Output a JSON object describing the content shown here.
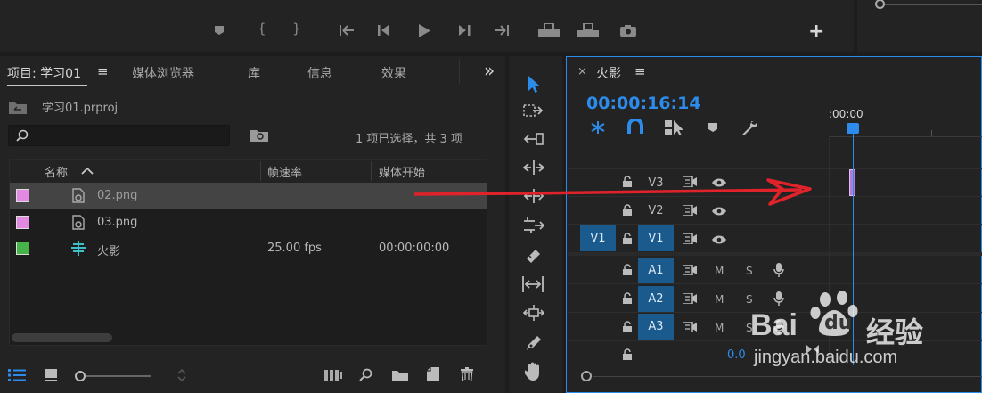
{
  "program_monitor": {
    "add_label": "+"
  },
  "project_panel": {
    "tabs": [
      {
        "label": "项目: 学习01"
      },
      {
        "label": "媒体浏览器"
      },
      {
        "label": "库"
      },
      {
        "label": "信息"
      },
      {
        "label": "效果"
      }
    ],
    "menu_glyph": "≡",
    "overflow_glyph": "»",
    "project_file": "学习01.prproj",
    "search_placeholder": "",
    "selection_status": "1 项已选择，共 3 项",
    "columns": [
      "名称",
      "帧速率",
      "媒体开始"
    ],
    "items": [
      {
        "name": "02.png",
        "frame_rate": "",
        "media_start": "",
        "color": "#e28ae2"
      },
      {
        "name": "03.png",
        "frame_rate": "",
        "media_start": "",
        "color": "#e28ae2"
      },
      {
        "name": "火影",
        "frame_rate": "25.00 fps",
        "media_start": "00:00:00:00",
        "color": "#46b449"
      }
    ]
  },
  "timeline": {
    "close_glyph": "×",
    "sequence_name": "火影",
    "menu_glyph": "≡",
    "timecode": "00:00:16:14",
    "ruler_label": ":00:00",
    "source_patch": "V1",
    "video_tracks": [
      "V3",
      "V2",
      "V1"
    ],
    "audio_tracks": [
      "A1",
      "A2",
      "A3"
    ],
    "mute_label": "M",
    "solo_label": "S",
    "master_value": "0.0",
    "accent_color": "#2d8ceb"
  },
  "watermark": {
    "brand": "Bai",
    "brand_suffix": "du",
    "service": "经验",
    "url": "jingyan.baidu.com"
  }
}
